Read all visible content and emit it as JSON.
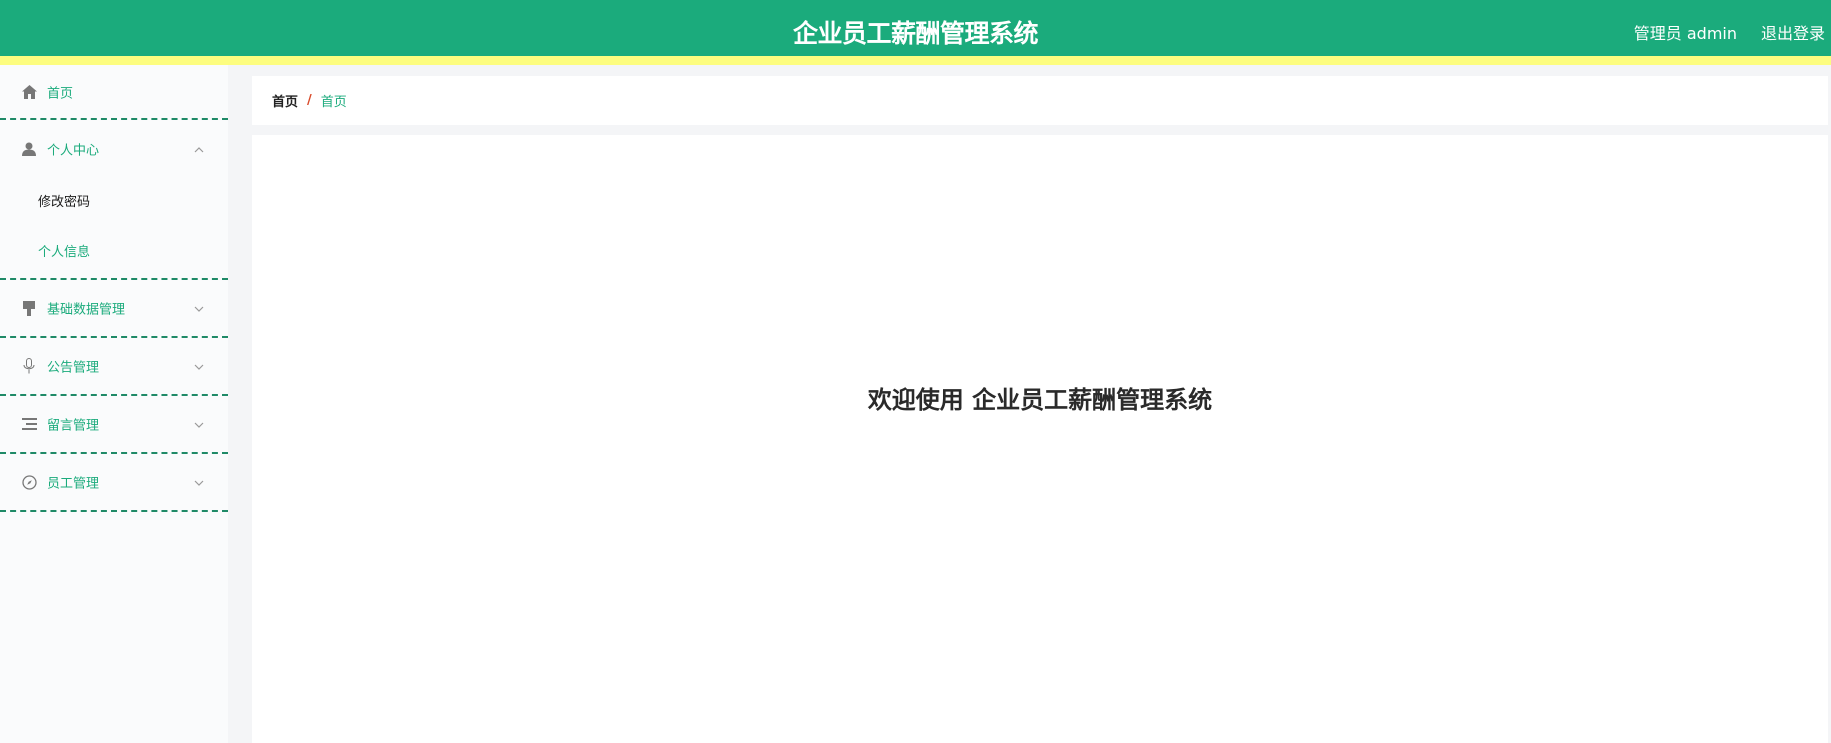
{
  "header": {
    "title": "企业员工薪酬管理系统",
    "user_label": "管理员 admin",
    "logout_label": "退出登录"
  },
  "sidebar": {
    "items": [
      {
        "label": "首页",
        "icon": "home-icon"
      },
      {
        "label": "个人中心",
        "icon": "user-icon",
        "expanded": true,
        "children": [
          {
            "label": "修改密码"
          },
          {
            "label": "个人信息"
          }
        ]
      },
      {
        "label": "基础数据管理",
        "icon": "brush-icon"
      },
      {
        "label": "公告管理",
        "icon": "microphone-icon"
      },
      {
        "label": "留言管理",
        "icon": "list-icon"
      },
      {
        "label": "员工管理",
        "icon": "compass-icon"
      }
    ]
  },
  "breadcrumb": {
    "home": "首页",
    "separator": "/",
    "current": "首页"
  },
  "main": {
    "welcome": "欢迎使用 企业员工薪酬管理系统"
  },
  "colors": {
    "primary": "#1bab7c",
    "accent_bar": "#fdfd7f",
    "separator": "#d94b2b"
  }
}
